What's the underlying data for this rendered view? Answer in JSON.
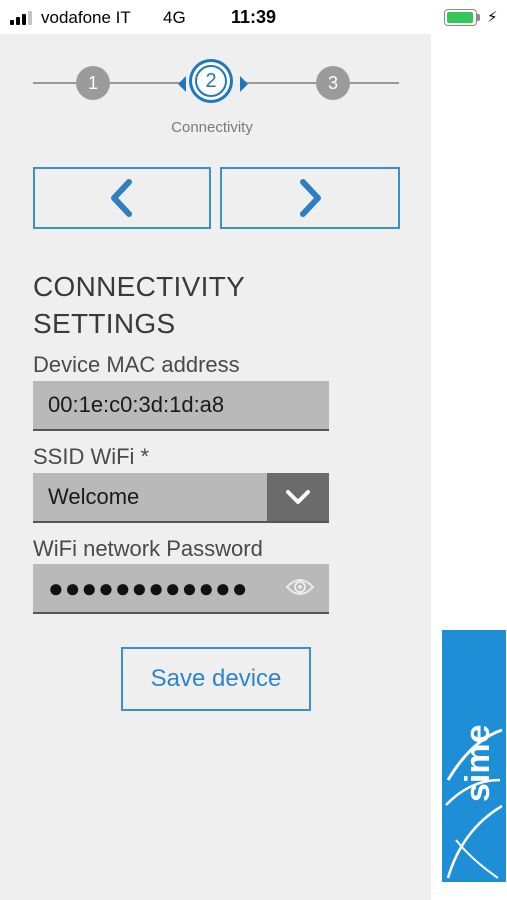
{
  "status_bar": {
    "carrier": "vodafone IT",
    "network": "4G",
    "time": "11:39"
  },
  "stepper": {
    "steps": [
      {
        "number": "1"
      },
      {
        "number": "2",
        "label": "Connectivity",
        "active": true
      },
      {
        "number": "3"
      }
    ],
    "accent_color": "#1e78bd"
  },
  "heading": {
    "line1": "CONNECTIVITY",
    "line2": "SETTINGS"
  },
  "form": {
    "mac": {
      "label": "Device MAC address",
      "value": "00:1e:c0:3d:1d:a8"
    },
    "ssid": {
      "label": "SSID WiFi *",
      "value": "Welcome"
    },
    "password": {
      "label": "WiFi network Password",
      "value_masked": "●●●●●●●●●●●●"
    },
    "save_label": "Save device"
  },
  "brand": {
    "logo_text": "sime",
    "color": "#1e8fd6"
  },
  "icons": {
    "prev": "chevron-left-icon",
    "next": "chevron-right-icon",
    "dropdown": "chevron-down-icon",
    "reveal": "eye-icon"
  }
}
